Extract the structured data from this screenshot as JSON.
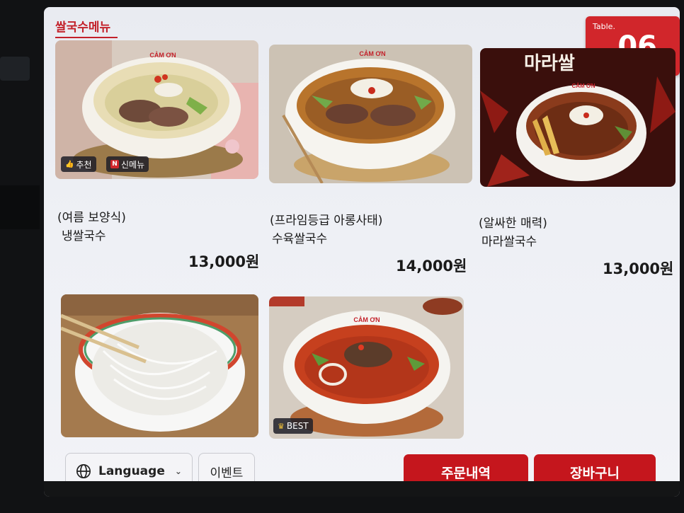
{
  "category": {
    "title": "쌀국수메뉴"
  },
  "table": {
    "label": "Table.",
    "number": "06"
  },
  "menu_items": [
    {
      "subtitle": "(여름 보양식)",
      "name": "냉쌀국수",
      "price": "13,000원",
      "tags": [
        {
          "icon": "thumbs-up-icon",
          "label": "추천"
        },
        {
          "icon": "new-badge-icon",
          "glyph": "N",
          "label": "신메뉴"
        }
      ]
    },
    {
      "subtitle": "(프라임등급 아롱사태)",
      "name": "수육쌀국수",
      "price": "14,000원",
      "tags": []
    },
    {
      "subtitle": "(알싸한 매력)",
      "name": "마라쌀국수",
      "price": "13,000원",
      "tags": []
    },
    {
      "subtitle": "",
      "name": "",
      "price": "",
      "tags": []
    },
    {
      "subtitle": "",
      "name": "",
      "price": "",
      "tags": [
        {
          "icon": "crown-icon",
          "label": "BEST"
        }
      ]
    }
  ],
  "bowl_brand": "CẢM ƠN",
  "promo_text": "마라쌀",
  "footer": {
    "language_label": "Language",
    "event_label": "이벤트",
    "order_history_label": "주문내역",
    "cart_label": "장바구니"
  },
  "colors": {
    "accent": "#c5161d",
    "badge": "#d1262b",
    "text": "#1a1a1a"
  }
}
